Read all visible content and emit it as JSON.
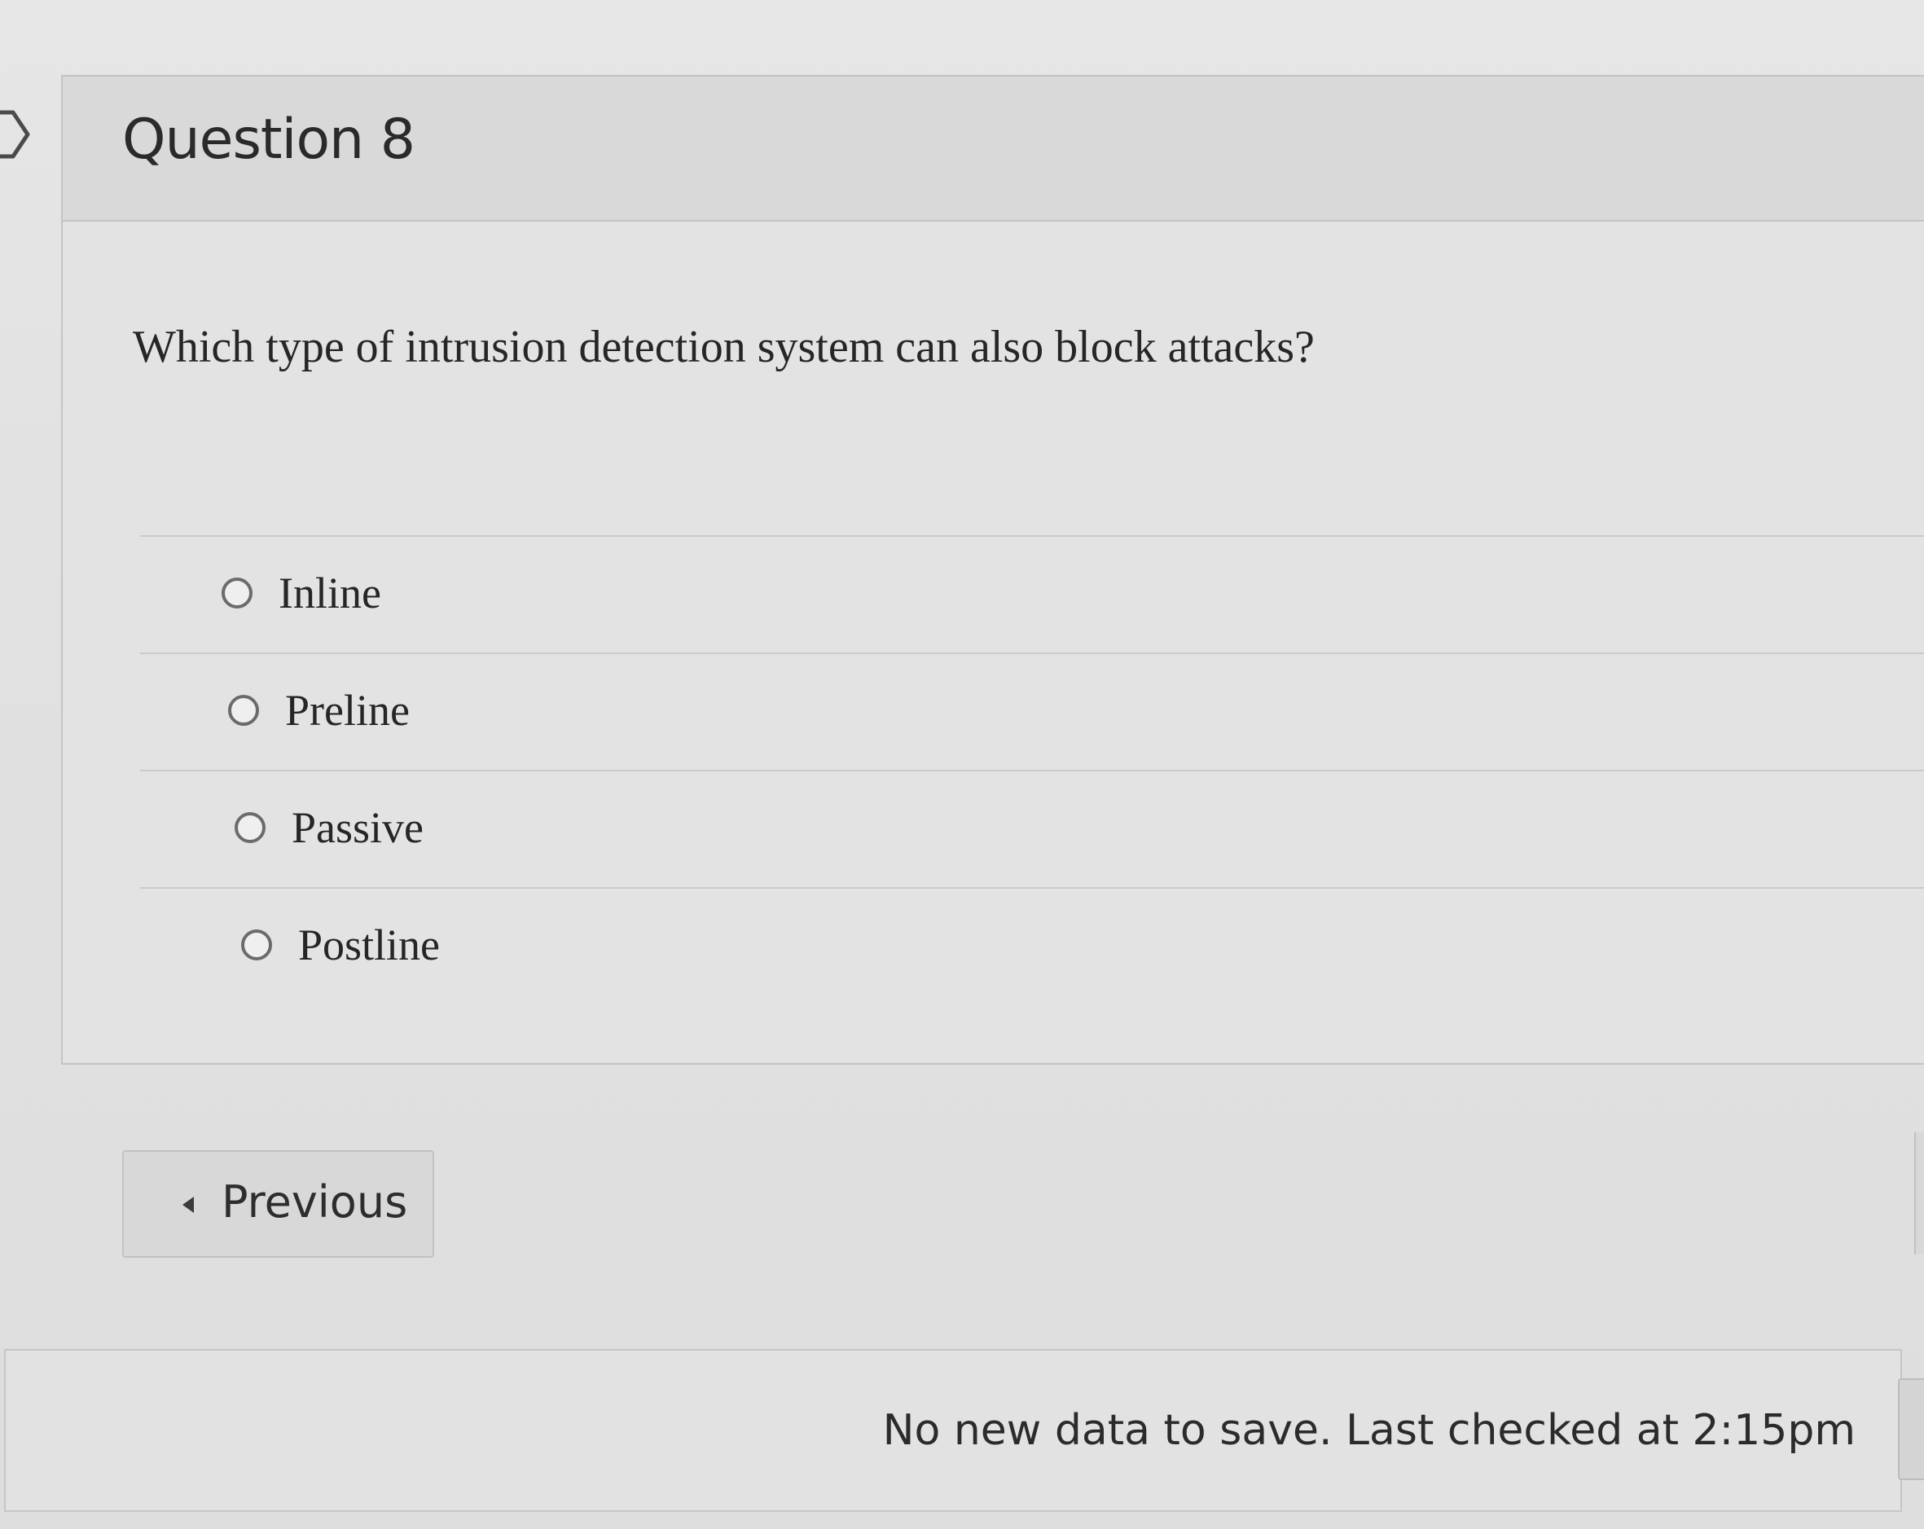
{
  "question": {
    "title": "Question 8",
    "text": "Which type of intrusion detection system can also block attacks?",
    "answers": [
      {
        "label": "Inline",
        "selected": false
      },
      {
        "label": "Preline",
        "selected": false
      },
      {
        "label": "Passive",
        "selected": false
      },
      {
        "label": "Postline",
        "selected": false
      }
    ]
  },
  "navigation": {
    "previous_label": "Previous"
  },
  "status": {
    "text": "No new data to save. Last checked at 2:15pm"
  },
  "icons": {
    "flag": "question-flag-icon",
    "previous": "caret-left-icon",
    "radio": "radio-button-icon"
  }
}
